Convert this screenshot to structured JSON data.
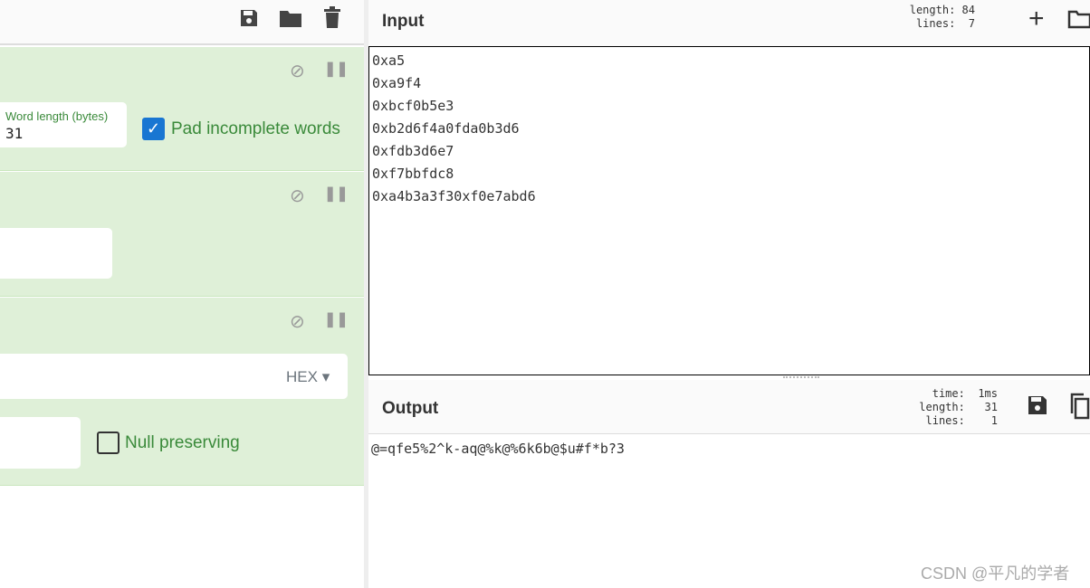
{
  "recipe": {
    "op1": {
      "word_length_label": "Word length (bytes)",
      "word_length_value": "31",
      "pad_checkbox_label": "Pad incomplete words",
      "pad_checked": true
    },
    "op3": {
      "key_format": "HEX",
      "null_preserving_label": "Null preserving",
      "null_checked": false
    }
  },
  "input": {
    "title": "Input",
    "length_label": "length:",
    "length": "84",
    "lines_label": "lines:",
    "lines": "7",
    "lines_text": [
      "0xa5",
      "0xa9f4",
      "0xbcf0b5e3",
      "0xb2d6f4a0fda0b3d6",
      "0xfdb3d6e7",
      "0xf7bbfdc8",
      "0xa4b3a3f30xf0e7abd6"
    ]
  },
  "output": {
    "title": "Output",
    "time_label": "time:",
    "time": "1ms",
    "length_label": "length:",
    "length": "31",
    "lines_label": "lines:",
    "lines": "1",
    "text": "@=qfe5%2^k-aq@%k@%6k6b@$u#f*b?3"
  },
  "watermark": "CSDN @平凡的学者",
  "colors": {
    "op_bg": "#dff0d8",
    "checkbox_blue": "#1976d2",
    "label_green": "#3a8a3a"
  }
}
